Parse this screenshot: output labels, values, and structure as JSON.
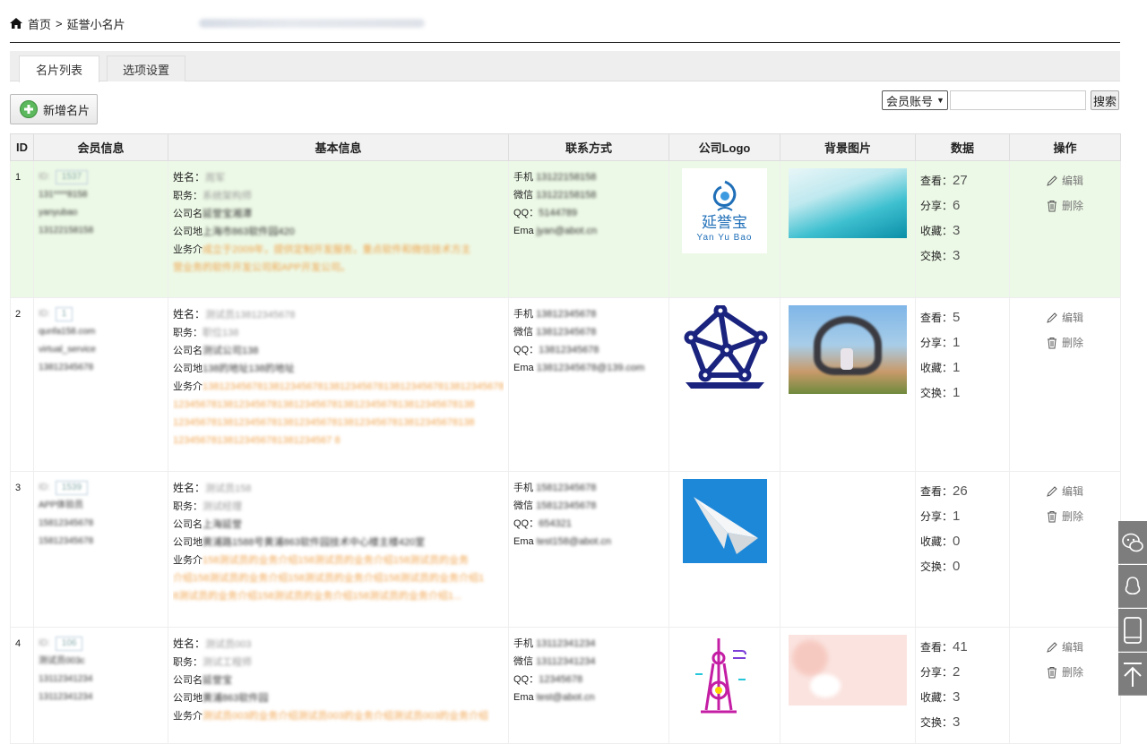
{
  "breadcrumb": {
    "home": "首页",
    "separator": ">",
    "current": "延誉小名片"
  },
  "tabs": [
    {
      "label": "名片列表",
      "active": true
    },
    {
      "label": "选项设置",
      "active": false
    }
  ],
  "toolbar": {
    "add_label": "新增名片",
    "search_select": "会员账号",
    "search_button": "搜索"
  },
  "columns": [
    "ID",
    "会员信息",
    "基本信息",
    "联系方式",
    "公司Logo",
    "背景图片",
    "数据",
    "操作"
  ],
  "labels": {
    "name": "姓名：",
    "job": "职务：",
    "company": "公司名",
    "address": "公司地",
    "business": "业务介",
    "phone": "手机",
    "wechat": "微信",
    "qq": "QQ：",
    "email": "Ema",
    "view": "查看：",
    "share": "分享：",
    "fav": "收藏：",
    "swap": "交换：",
    "edit": "编辑",
    "delete": "删除"
  },
  "logo_text": {
    "brand_cn": "延誉宝",
    "brand_en": "Yan Yu Bao"
  },
  "rows": [
    {
      "id": "1",
      "member_id": "1537",
      "m1": "131****8158",
      "m2": "yanyubao",
      "m3": "13122158158",
      "name": "周军",
      "job": "系统架构师",
      "company": "延誉宝湘潭",
      "address": "上海市863软件园420",
      "business1": "成立于2009年，提供定制开发服务，重点软件和微信技术方主",
      "business2": "营业务的软件开发公司和APP开发公司。",
      "phone": "13122158158",
      "wechat": "13122158158",
      "qq": "5144789",
      "email": "jyan@abot.cn",
      "view": "27",
      "share": "6",
      "fav": "3",
      "swap": "3"
    },
    {
      "id": "2",
      "member_id": "1",
      "m1": "qunfa158.com",
      "m2": "virtual_service",
      "m3": "13812345678",
      "name": "测试员13812345678",
      "job": "职位138",
      "company": "测试公司138",
      "address": "138的地址138的地址",
      "business1": "1381234567813812345678138123456781381234567813812345678138",
      "business2": "1234567813812345678138123456781381234567813812345678138",
      "business3": "1234567813812345678138123456781381234567813812345678138",
      "business4": "12345678138123456781381234567 8",
      "phone": "13812345678",
      "wechat": "13812345678",
      "qq": "13812345678",
      "email": "13812345678@139.com",
      "view": "5",
      "share": "1",
      "fav": "1",
      "swap": "1"
    },
    {
      "id": "3",
      "member_id": "1539",
      "m1": "APP体验员",
      "m2": "15812345678",
      "m3": "15812345678",
      "name": "测试员158",
      "job": "测试经理",
      "company": "上海延誉",
      "address": "黄浦路1588号黄浦863软件园技术中心楼主楼420室",
      "business1": "158测试员的业务介绍158测试员的业务介绍158测试员的业务",
      "business2": "介绍158测试员的业务介绍158测试员的业务介绍158测试员的业务介绍1",
      "business3": "8测试员的业务介绍158测试员的业务介绍158测试员的业务介绍1...",
      "phone": "15812345678",
      "wechat": "15812345678",
      "qq": "654321",
      "email": "test158@abot.cn",
      "view": "26",
      "share": "1",
      "fav": "0",
      "swap": "0"
    },
    {
      "id": "4",
      "member_id": "106",
      "m1": "测试员003c",
      "m2": "13112341234",
      "m3": "13112341234",
      "name": "测试员003",
      "job": "测试工程师",
      "company": "延誉宝",
      "address": "黄浦863软件园",
      "business1": "测试员003的业务介绍测试员003的业务介绍测试员003的业务介绍",
      "phone": "13112341234",
      "wechat": "13112341234",
      "qq": "12345678",
      "email": "test@abot.cn",
      "view": "41",
      "share": "2",
      "fav": "3",
      "swap": "3"
    }
  ]
}
